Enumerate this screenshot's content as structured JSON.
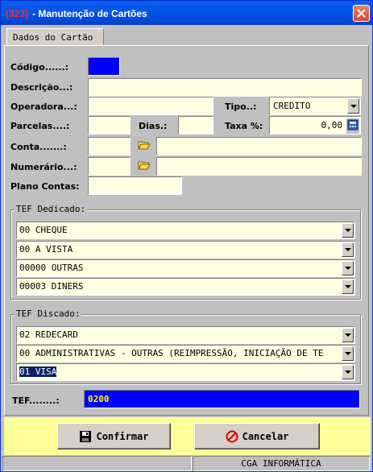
{
  "window": {
    "title_id": "(323)",
    "title": "- Manutenção de Cartões",
    "close_icon": "close-icon"
  },
  "tab": {
    "label": "Dados do Cartão"
  },
  "form": {
    "codigo_label": "Código......:",
    "codigo_value": "",
    "descricao_label": "Descrição...:",
    "descricao_value": "",
    "operadora_label": "Operadora...:",
    "operadora_value": "",
    "tipo_label": "Tipo..:",
    "tipo_value": "CREDITO",
    "parcelas_label": "Parcelas....:",
    "parcelas_value": "",
    "dias_label": "Dias.:",
    "dias_value": "",
    "taxa_label": "Taxa %:",
    "taxa_value": "0,00",
    "conta_label": "Conta.......:",
    "conta_code": "",
    "conta_desc": "",
    "numerario_label": "Numerário...:",
    "numerario_code": "",
    "numerario_desc": "",
    "plano_contas_label": "Plano Contas:",
    "plano_contas_value": ""
  },
  "tef_dedicado": {
    "title": "TEF Dedicado:",
    "options": [
      "00 CHEQUE",
      "00 A VISTA",
      "00000 OUTRAS",
      "00003 DINERS"
    ]
  },
  "tef_discado": {
    "title": "TEF Discado:",
    "options": [
      "02 REDECARD",
      "00 ADMINISTRATIVAS - OUTRAS (REIMPRESSÃO, INICIAÇÃO DE TE",
      "01 VISA"
    ]
  },
  "tef": {
    "label": "TEF........:",
    "value": "0200"
  },
  "buttons": {
    "confirmar": "Confirmar",
    "cancelar": "Cancelar"
  },
  "status": {
    "left": "",
    "right": "CGA INFORMÁTICA"
  },
  "colors": {
    "accent": "#0000ff",
    "field_bg": "#ffffe1",
    "footer_bg": "#ffff99",
    "title_id": "#ff2a2a"
  }
}
